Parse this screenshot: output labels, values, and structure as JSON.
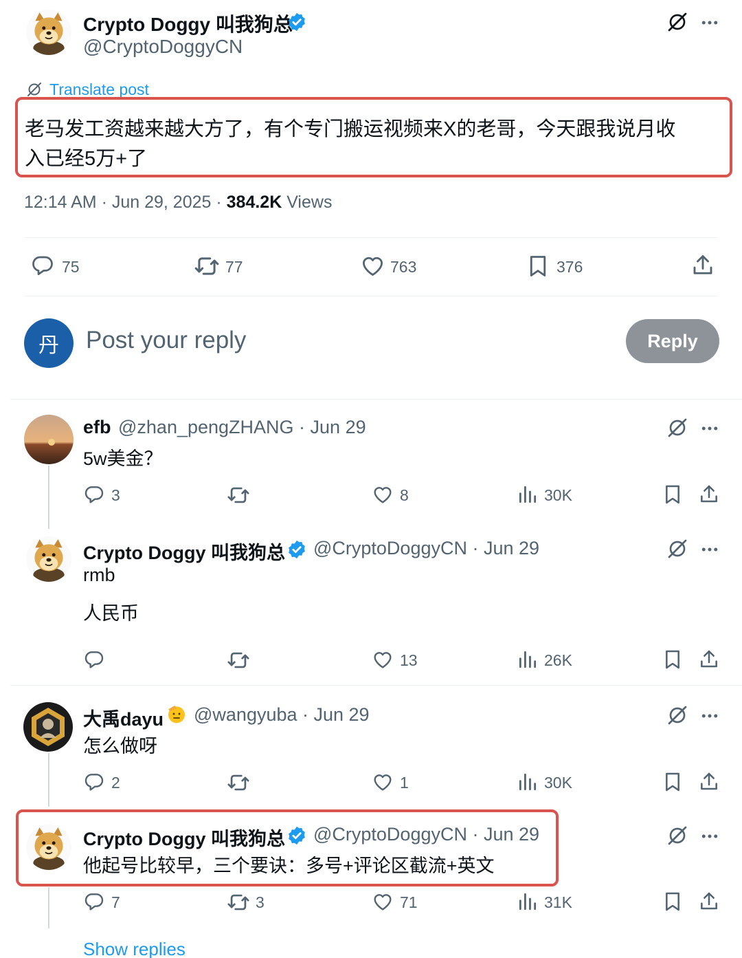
{
  "main_post": {
    "display_name": "Crypto Doggy 叫我狗总",
    "handle": "@CryptoDoggyCN",
    "translate_label": "Translate post",
    "text_line1": "老马发工资越来越大方了，有个专门搬运视频来X的老哥，今天跟我说月收",
    "text_line2": "入已经5万+了",
    "timestamp": "12:14 AM · Jun 29, 2025 · ",
    "views_count": "384.2K",
    "views_label": " Views",
    "replies": "75",
    "reposts": "77",
    "likes": "763",
    "bookmarks": "376"
  },
  "reply_box": {
    "avatar_letter": "丹",
    "placeholder": "Post your reply",
    "button_label": "Reply"
  },
  "replies": [
    {
      "display_name": "efb",
      "meta": "@zhan_pengZHANG · Jun 29",
      "text": "5w美金？",
      "replies": "3",
      "reposts": "",
      "likes": "8",
      "views": "30K"
    },
    {
      "display_name": "Crypto Doggy 叫我狗总",
      "meta": "@CryptoDoggyCN · Jun 29",
      "text_line1": "rmb",
      "text_line2": "人民币",
      "replies": "",
      "reposts": "",
      "likes": "13",
      "views": "26K"
    },
    {
      "display_name": "大禹dayu",
      "meta": "@wangyuba · Jun 29",
      "text": "怎么做呀",
      "replies": "2",
      "reposts": "",
      "likes": "1",
      "views": "30K"
    },
    {
      "display_name": "Crypto Doggy 叫我狗总",
      "meta": "@CryptoDoggyCN · Jun 29",
      "text": "他起号比较早，三个要诀：多号+评论区截流+英文",
      "replies": "7",
      "reposts": "3",
      "likes": "71",
      "views": "31K"
    }
  ],
  "show_replies_label": "Show replies",
  "colors": {
    "verified_blue": "#1d9bf0",
    "link_blue": "#1d9bf0",
    "highlight_red": "#d9534f",
    "reply_avatar_blue": "#1a5fa8",
    "reply_button_grey": "#8e9399"
  }
}
